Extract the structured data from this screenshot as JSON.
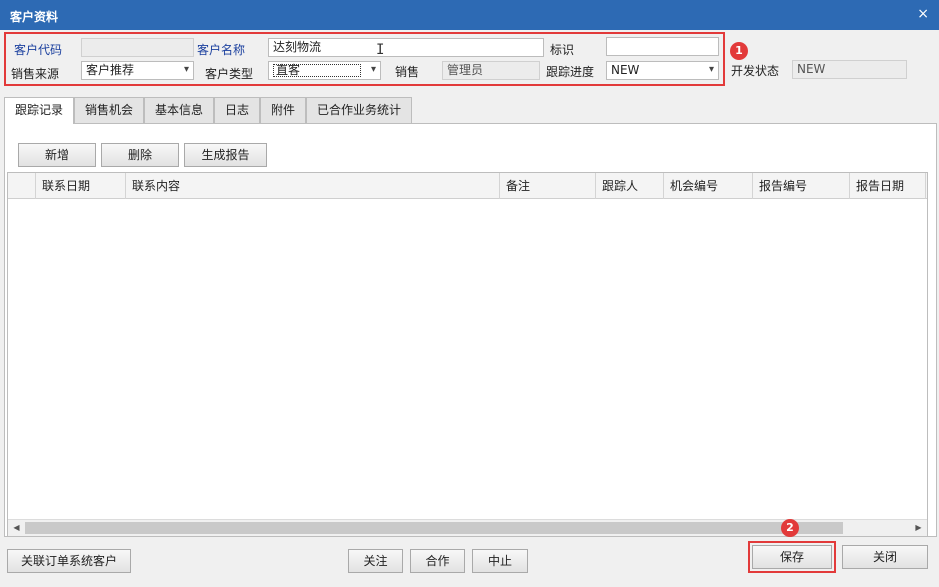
{
  "window": {
    "title": "客户资料",
    "close_glyph": "×"
  },
  "form": {
    "customer_code": {
      "label": "客户代码",
      "value": ""
    },
    "customer_name": {
      "label": "客户名称",
      "value": "达刻物流"
    },
    "identifier": {
      "label": "标识",
      "value": ""
    },
    "sales_source": {
      "label": "销售来源",
      "value": "客户推荐"
    },
    "customer_type": {
      "label": "客户类型",
      "value": "直客"
    },
    "sales": {
      "label": "销售",
      "value": "管理员"
    },
    "follow_progress": {
      "label": "跟踪进度",
      "value": "NEW"
    },
    "dev_status": {
      "label": "开发状态",
      "value": "NEW"
    }
  },
  "annotations": {
    "badge1": "1",
    "badge2": "2",
    "accent_color": "#e23a3a"
  },
  "tabs": [
    {
      "label": "跟踪记录",
      "active": true
    },
    {
      "label": "销售机会",
      "active": false
    },
    {
      "label": "基本信息",
      "active": false
    },
    {
      "label": "日志",
      "active": false
    },
    {
      "label": "附件",
      "active": false
    },
    {
      "label": "已合作业务统计",
      "active": false
    }
  ],
  "toolbar": {
    "add": "新增",
    "delete": "删除",
    "report": "生成报告"
  },
  "table": {
    "columns": [
      "",
      "联系日期",
      "联系内容",
      "备注",
      "跟踪人",
      "机会编号",
      "报告编号",
      "报告日期"
    ],
    "rows": []
  },
  "footer": {
    "link_customer": "关联订单系统客户",
    "follow": "关注",
    "cooperate": "合作",
    "stop": "中止",
    "save": "保存",
    "close": "关闭"
  },
  "colors": {
    "titlebar": "#2d6ab4",
    "label_blue": "#1a3f9e"
  }
}
